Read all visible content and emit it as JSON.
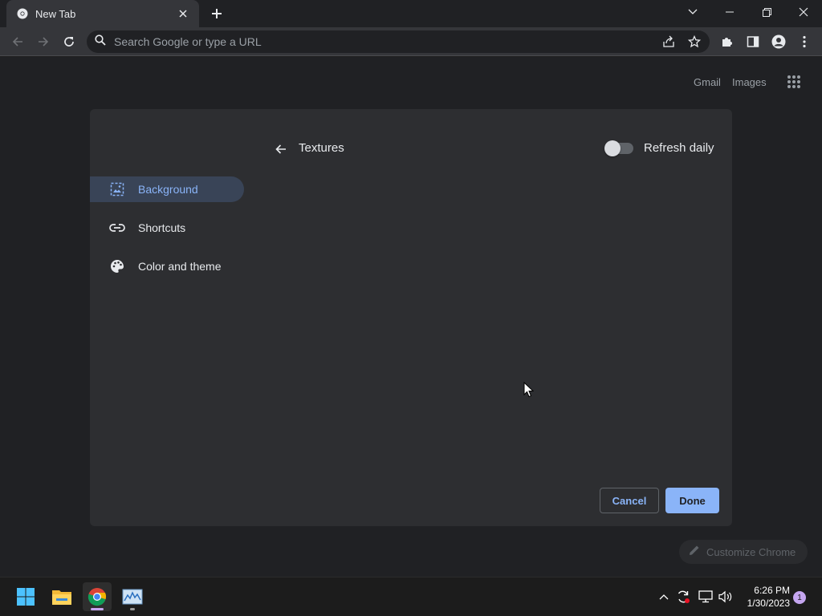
{
  "browser": {
    "tab_title": "New Tab",
    "omnibox_placeholder": "Search Google or type a URL"
  },
  "ntp": {
    "gmail": "Gmail",
    "images": "Images",
    "customize_label": "Customize Chrome"
  },
  "dialog": {
    "nav": [
      {
        "label": "Background",
        "icon": "image-icon",
        "active": true
      },
      {
        "label": "Shortcuts",
        "icon": "link-icon",
        "active": false
      },
      {
        "label": "Color and theme",
        "icon": "palette-icon",
        "active": false
      }
    ],
    "section_title": "Textures",
    "refresh_daily_label": "Refresh daily",
    "refresh_daily_on": false,
    "cancel_label": "Cancel",
    "done_label": "Done"
  },
  "taskbar": {
    "time": "6:26 PM",
    "date": "1/30/2023",
    "notification_count": "1"
  },
  "colors": {
    "accent": "#8ab4f8",
    "dialog_bg": "#2d2e31",
    "page_bg": "#202124"
  }
}
